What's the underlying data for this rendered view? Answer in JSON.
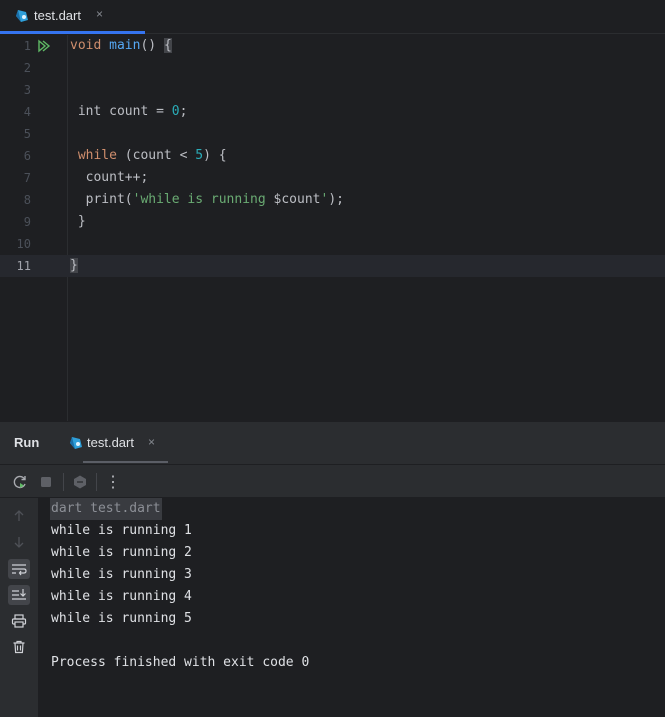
{
  "editor_tab": {
    "filename": "test.dart",
    "close": "×"
  },
  "editor": {
    "line_numbers": [
      "1",
      "2",
      "3",
      "4",
      "5",
      "6",
      "7",
      "8",
      "9",
      "10",
      "11"
    ],
    "code": {
      "l1_kw": "void",
      "l1_fn": "main",
      "l1_rest": "() ",
      "l1_brace": "{",
      "l4_pre": " int count = ",
      "l4_num": "0",
      "l4_post": ";",
      "l6_kw": " while",
      "l6_mid": " (count < ",
      "l6_num": "5",
      "l6_post": ") {",
      "l7": "  count++;",
      "l8_pre": "  print(",
      "l8_str": "'while is running ",
      "l8_var": "$count",
      "l8_str2": "'",
      "l8_post": ");",
      "l9": " }",
      "l11": "}"
    }
  },
  "run_panel": {
    "title": "Run",
    "tab_filename": "test.dart",
    "tab_close": "×",
    "toolbar": [
      "rerun-icon",
      "stop-icon",
      "debug-icon",
      "more-icon"
    ],
    "more_label": "⋮",
    "sidebar": [
      "up-arrow-icon",
      "down-arrow-icon",
      "soft-wrap-icon",
      "scroll-to-end-icon",
      "print-icon",
      "trash-icon"
    ],
    "console": {
      "command": "dart test.dart",
      "lines": [
        "while is running 1",
        "while is running 2",
        "while is running 3",
        "while is running 4",
        "while is running 5"
      ],
      "exit": "Process finished with exit code 0"
    }
  },
  "colors": {
    "accent": "#3574f0",
    "keyword": "#cf8e6d",
    "function": "#56a8f5",
    "number": "#2aacb8",
    "string": "#6aab73"
  }
}
